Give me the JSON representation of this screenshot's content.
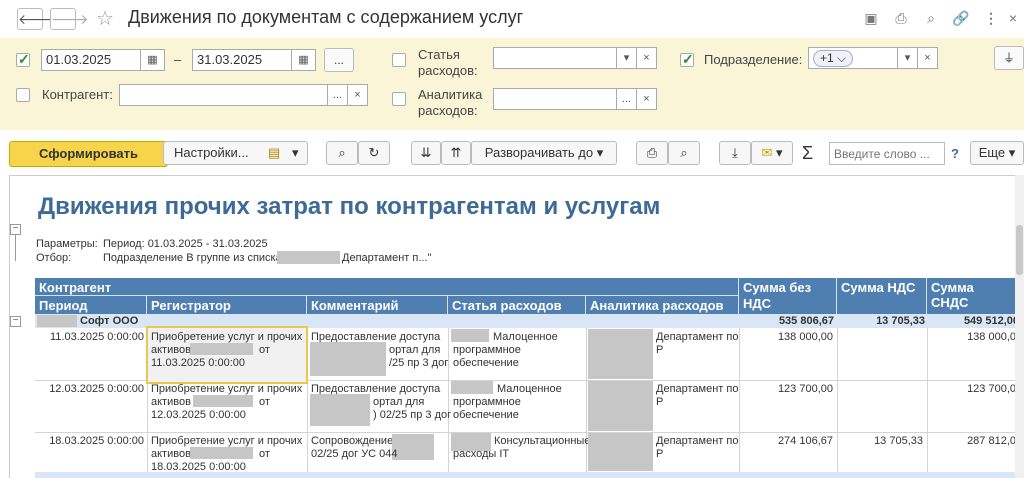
{
  "window": {
    "title": "Движения по документам с содержанием услуг"
  },
  "filters": {
    "date_from": "01.03.2025",
    "date_to": "31.03.2025",
    "date_dash": "–",
    "ellipsis": "...",
    "clear": "×",
    "counterparty_label": "Контрагент:",
    "expense_item_label_1": "Статья",
    "expense_item_label_2": "расходов:",
    "expense_analytics_label_1": "Аналитика",
    "expense_analytics_label_2": "расходов:",
    "department_label": "Подразделение:",
    "department_value": "+1"
  },
  "toolbar": {
    "generate": "Сформировать",
    "settings": "Настройки...",
    "expand_to": "Разворачивать до",
    "search_placeholder": "Введите слово ...",
    "help": "?",
    "more": "Еще",
    "sigma": "Σ"
  },
  "report": {
    "title": "Движения прочих затрат по контрагентам и услугам",
    "params_label": "Параметры:",
    "params_value": "Период: 01.03.2025 - 31.03.2025",
    "filter_label": "Отбор:",
    "filter_value_prefix": "Подразделение В группе из списка \"",
    "filter_value_suffix": "Департамент п...\"",
    "headers": {
      "counterparty": "Контрагент",
      "period": "Период",
      "registrar": "Регистратор",
      "comment": "Комментарий",
      "expense_item": "Статья расходов",
      "expense_analytics": "Аналитика расходов",
      "sum_no_vat_1": "Сумма без",
      "sum_no_vat_2": "НДС",
      "sum_vat": "Сумма НДС",
      "sum_with_vat": "Сумма СНДС"
    },
    "group": {
      "name": "Софт ООО",
      "sum_no_vat": "535 806,67",
      "sum_vat": "13 705,33",
      "sum_with_vat": "549 512,00"
    },
    "rows": [
      {
        "period": "11.03.2025 0:00:00",
        "registrar_1": "Приобретение услуг и прочих",
        "registrar_2": "активов",
        "registrar_2b": "от",
        "registrar_3": "11.03.2025 0:00:00",
        "comment_1": "Предоставление доступа к",
        "comment_2": "ортал для",
        "comment_3": "/25 пр 3 дог",
        "item_1": "Малоценное",
        "item_2": "программное",
        "item_3": "обеспечение",
        "analytics": "Департамент по",
        "analytics_2": "Р",
        "sum_no_vat": "138 000,00",
        "sum_vat": "",
        "sum_with_vat": "138 000,0"
      },
      {
        "period": "12.03.2025 0:00:00",
        "registrar_1": "Приобретение услуг и прочих",
        "registrar_2": "активов 2",
        "registrar_2b": "от",
        "registrar_3": "12.03.2025 0:00:00",
        "comment_1": "Предоставление доступа к",
        "comment_2": "ортал для",
        "comment_3": ") 02/25 пр 3 дог",
        "item_1": "Малоценное",
        "item_2": "программное",
        "item_3": "обеспечение",
        "analytics": "Департамент по",
        "analytics_2": "Р",
        "sum_no_vat": "123 700,00",
        "sum_vat": "",
        "sum_with_vat": "123 700,0"
      },
      {
        "period": "18.03.2025 0:00:00",
        "registrar_1": "Приобретение услуг и прочих",
        "registrar_2": "активов",
        "registrar_2b": "от",
        "registrar_3": "18.03.2025 0:00:00",
        "comment_1": "Сопровождение",
        "comment_2": "02/25 дог УС 044",
        "comment_3": "",
        "item_1": "Консультационные",
        "item_2": "расходы IT",
        "item_3": "",
        "analytics": "Департамент по",
        "analytics_2": "Р",
        "sum_no_vat": "274 106,67",
        "sum_vat": "13 705,33",
        "sum_with_vat": "287 812,0"
      }
    ]
  }
}
